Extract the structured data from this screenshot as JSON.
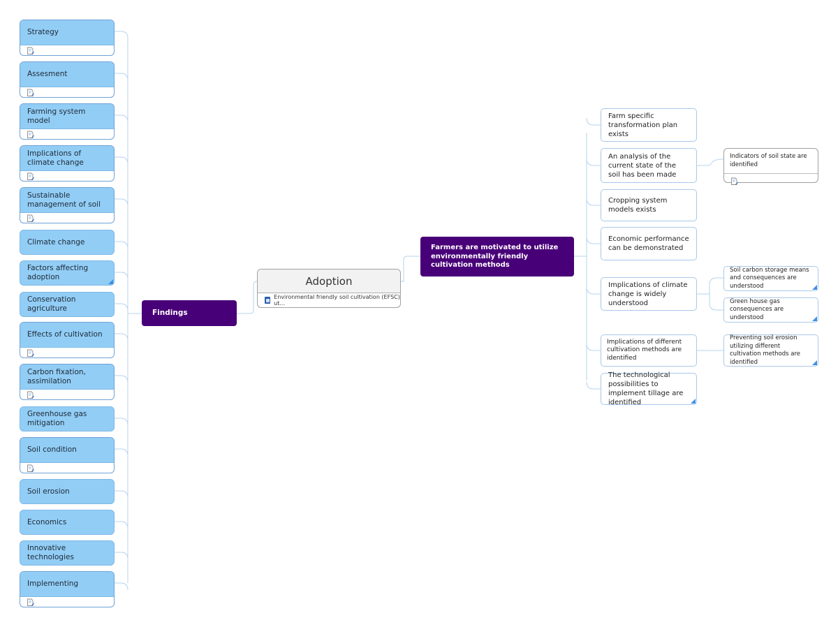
{
  "central": {
    "title": "Adoption",
    "attachment_label": "Environmental friendly soil cultivation (EFSC) ut...",
    "attachment_icon": "document-icon"
  },
  "findings": {
    "label": "Findings",
    "children": [
      {
        "label": "Strategy",
        "has_note": true,
        "has_corner": false
      },
      {
        "label": "Assesment",
        "has_note": true,
        "has_corner": false
      },
      {
        "label": "Farming system model",
        "has_note": true,
        "has_corner": false
      },
      {
        "label": "Implications of climate change",
        "has_note": true,
        "has_corner": false
      },
      {
        "label": "Sustainable management of soil",
        "has_note": true,
        "has_corner": false
      },
      {
        "label": "Climate change",
        "has_note": false,
        "has_corner": false
      },
      {
        "label": "Factors affecting adoption",
        "has_note": false,
        "has_corner": true
      },
      {
        "label": "Conservation agriculture",
        "has_note": false,
        "has_corner": false
      },
      {
        "label": "Effects of cultivation",
        "has_note": true,
        "has_corner": false
      },
      {
        "label": "Carbon fixation, assimilation",
        "has_note": true,
        "has_corner": false
      },
      {
        "label": "Greenhouse gas mitigation",
        "has_note": false,
        "has_corner": false
      },
      {
        "label": "Soil condition",
        "has_note": true,
        "has_corner": false
      },
      {
        "label": "Soil erosion",
        "has_note": false,
        "has_corner": false
      },
      {
        "label": "Economics",
        "has_note": false,
        "has_corner": false
      },
      {
        "label": "Innovative technologies",
        "has_note": false,
        "has_corner": false
      },
      {
        "label": "Implementing",
        "has_note": true,
        "has_corner": false
      }
    ]
  },
  "motivation": {
    "label": "Farmers are motivated to utilize environmentally friendly cultivation methods",
    "children": [
      {
        "label": "Farm specific transformation plan exists"
      },
      {
        "label": "An analysis of the current state of the soil has been made",
        "children": [
          {
            "label": "Indicators of soil state are identified",
            "has_note": true
          }
        ]
      },
      {
        "label": "Cropping system models exists"
      },
      {
        "label": "Economic performance can be demonstrated"
      },
      {
        "label": "Implications of climate change is widely understood",
        "children": [
          {
            "label": "Soil carbon storage means and consequences are understood",
            "has_corner": true
          },
          {
            "label": "Green house gas consequences are understood",
            "has_corner": true
          }
        ]
      },
      {
        "label": "Implications of different cultivation methods are identified",
        "children": [
          {
            "label": "Preventing soil erosion utilizing different cultivation methods are identified",
            "has_corner": true
          }
        ]
      },
      {
        "label": "The technological possibilities to implement tillage are identified",
        "has_corner": true
      }
    ]
  },
  "colors": {
    "findings_topic": "#480078",
    "left_topic_fill": "#92cdf5",
    "link_line": "#b7d3ee",
    "corner_marker": "#3d8ee6"
  }
}
